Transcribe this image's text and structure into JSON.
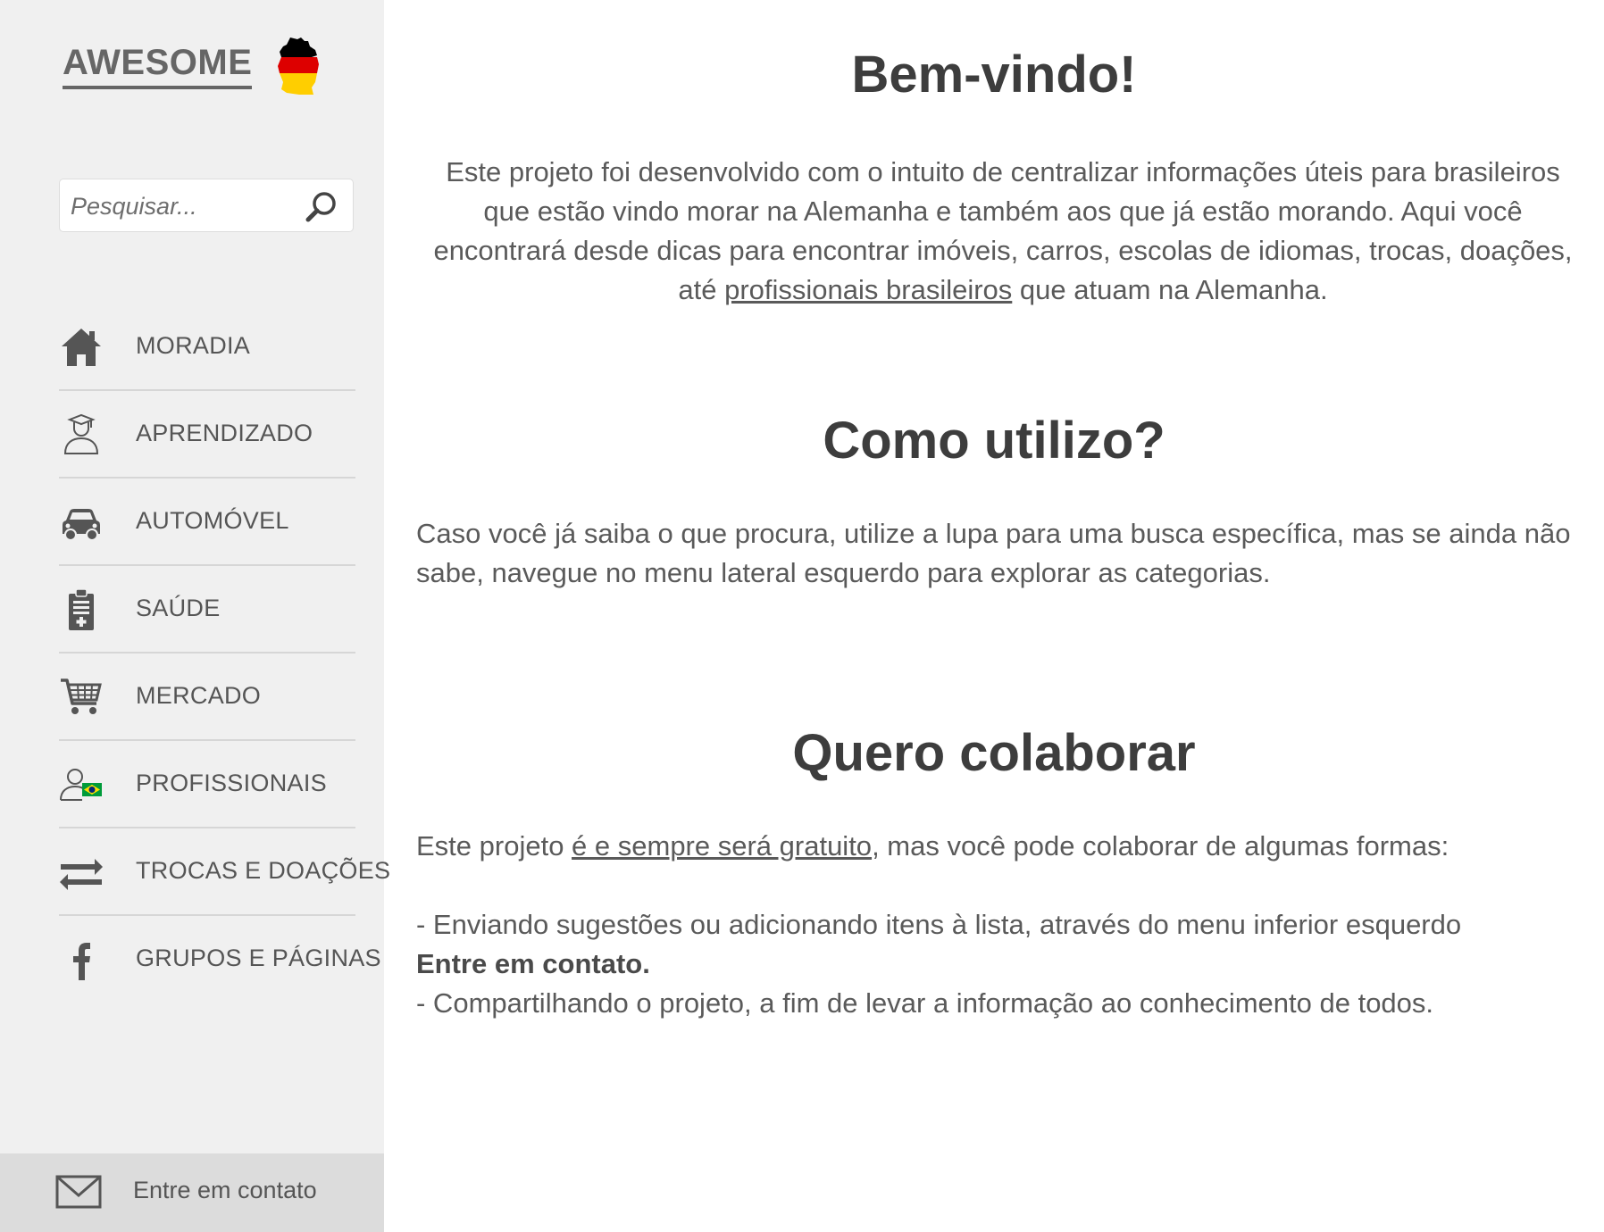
{
  "sidebar": {
    "logo": "AWESOME",
    "search": {
      "placeholder": "Pesquisar..."
    },
    "items": [
      {
        "label": "MORADIA",
        "icon": "home-icon"
      },
      {
        "label": "APRENDIZADO",
        "icon": "graduate-icon"
      },
      {
        "label": "AUTOMÓVEL",
        "icon": "car-icon"
      },
      {
        "label": "SAÚDE",
        "icon": "clipboard-medical-icon"
      },
      {
        "label": "MERCADO",
        "icon": "shopping-cart-icon"
      },
      {
        "label": "PROFISSIONAIS",
        "icon": "professional-brazil-icon"
      },
      {
        "label": "TROCAS E DOAÇÕES",
        "icon": "exchange-arrows-icon"
      },
      {
        "label": "GRUPOS E PÁGINAS",
        "icon": "facebook-icon"
      }
    ],
    "contact": {
      "label": "Entre em contato",
      "icon": "mail-icon"
    }
  },
  "main": {
    "welcome": {
      "title": "Bem-vindo!",
      "text_before": "Este projeto foi desenvolvido com o intuito de centralizar informações úteis para brasileiros que estão vindo morar na Alemanha e também aos que já estão morando. Aqui você encontrará desde dicas para encontrar imóveis, carros, escolas de idiomas, trocas, doações, até ",
      "link": "profissionais brasileiros",
      "text_after": " que atuam na Alemanha."
    },
    "howto": {
      "title": "Como utilizo?",
      "text": "Caso você já saiba o que procura, utilize a lupa para uma busca específica, mas se ainda não sabe, navegue no menu lateral esquerdo para explorar as categorias."
    },
    "collaborate": {
      "title": "Quero colaborar",
      "intro_before": "Este projeto ",
      "intro_link": "é e sempre será gratuito",
      "intro_after": ", mas você pode colaborar de algumas formas:",
      "bullet1": "- Enviando sugestões ou adicionando itens à lista, através do menu inferior esquerdo",
      "bullet1_bold": "Entre em contato.",
      "bullet2": "- Compartilhando o projeto, a fim de levar a informação ao conhecimento de todos."
    }
  },
  "colors": {
    "sidebar_bg": "#f0f0f0",
    "contact_bg": "#dcdcdc",
    "heading": "#3d3d3d",
    "text": "#5a5a5a",
    "flag": [
      "#000000",
      "#dd0000",
      "#ffce00"
    ]
  }
}
